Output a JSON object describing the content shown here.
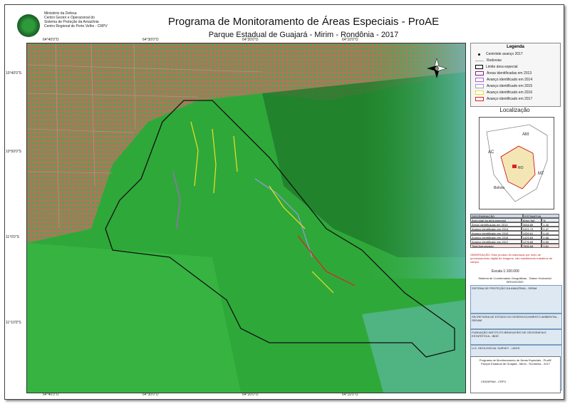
{
  "header": {
    "institution": [
      "Ministério da Defesa",
      "Centro Gestor e Operacional do",
      "Sistema de Proteção da Amazônia",
      "Centro Regional de Porto Velho - CRPV"
    ],
    "title": "Programa de Monitoramento de Áreas Especiais - ProAE",
    "subtitle": "Parque Estadual de Guajará - Mirim - Rondônia - 2017"
  },
  "coords": {
    "top": [
      "64°40'0\"O",
      "64°30'0\"O",
      "64°20'0\"O",
      "64°10'0\"O"
    ],
    "bottom": [
      "64°40'0\"O",
      "64°30'0\"O",
      "64°20'0\"O",
      "64°10'0\"O"
    ],
    "left": [
      "10°40'0\"S",
      "10°50'0\"S",
      "11°0'0\"S",
      "11°10'0\"S"
    ]
  },
  "legend": {
    "title": "Legenda",
    "items": [
      {
        "label": "Centróide avanço 2017",
        "color": "#000000",
        "kind": "dot"
      },
      {
        "label": "Rodovias",
        "color": "#c8a0a0",
        "kind": "line"
      },
      {
        "label": "Limite área especial",
        "color": "#000000",
        "kind": "box"
      },
      {
        "label": "Áreas identificadas em 2013",
        "color": "#7a1f7a",
        "kind": "box"
      },
      {
        "label": "Avanço identificado em 2014",
        "color": "#b35fd0",
        "kind": "box"
      },
      {
        "label": "Avanço identificado em 2015",
        "color": "#9a9ae0",
        "kind": "box"
      },
      {
        "label": "Avanço identificado em 2016",
        "color": "#f0e020",
        "kind": "box"
      },
      {
        "label": "Avanço identificado em 2017",
        "color": "#e02020",
        "kind": "box"
      }
    ]
  },
  "location": {
    "title": "Localização",
    "labels": [
      "AM",
      "AC",
      "MT",
      "Bolívia",
      "RO"
    ]
  },
  "table": {
    "header": [
      "DISCRIMINAÇÃO",
      "ESTIMATIVA"
    ],
    "rows": [
      [
        "Área total da área especial",
        "Área (ha)",
        "%"
      ],
      [
        "Áreas identificadas em 2013",
        "3048,85",
        "1,40"
      ],
      [
        "Avanço identificado em 2014",
        "1021,74",
        "0,47"
      ],
      [
        "Avanço identificado em 2015",
        "1059,61",
        "0,49"
      ],
      [
        "Avanço identificado em 2016",
        "1429,83",
        "0,66"
      ],
      [
        "Avanço identificado em 2017",
        "1276,65",
        "0,59"
      ],
      [
        "Total Antropizado",
        "7836,68",
        "3,61"
      ]
    ]
  },
  "note": "OBSERVAÇÃO: Este produto foi elaborado por meio de processamento digital de imagens, não substituindo trabalhos de campo.",
  "scale": "Escala 1:100.000",
  "datum": "Sistema de Coordenadas Geográficas - Datum Horizontal SIRGAS2000",
  "sources": [
    "SISTEMA DE PROTEÇÃO DA AMAZÔNIA - SIPAM",
    "SECRETARIA DE ESTADO DO DESENVOLVIMENTO AMBIENTAL - SEDAM",
    "FUNDAÇÃO INSTITUTO BRASILEIRO DE GEOGRAFIA E ESTATÍSTICA - IBGE",
    "U.S. GEOLOGICAL SURVEY - USGS"
  ],
  "footer": {
    "lines": [
      "Programa de Monitoramento de Áreas Especiais - ProAE",
      "Parque Estadual de Guajará - Mirim - Rondônia - 2017",
      "CENSIPAM - CRPV"
    ]
  },
  "colors": {
    "forest": "#2fa83a",
    "deforest": "#b9735f",
    "water": "#6fc0c8",
    "boundary": "#111111"
  }
}
